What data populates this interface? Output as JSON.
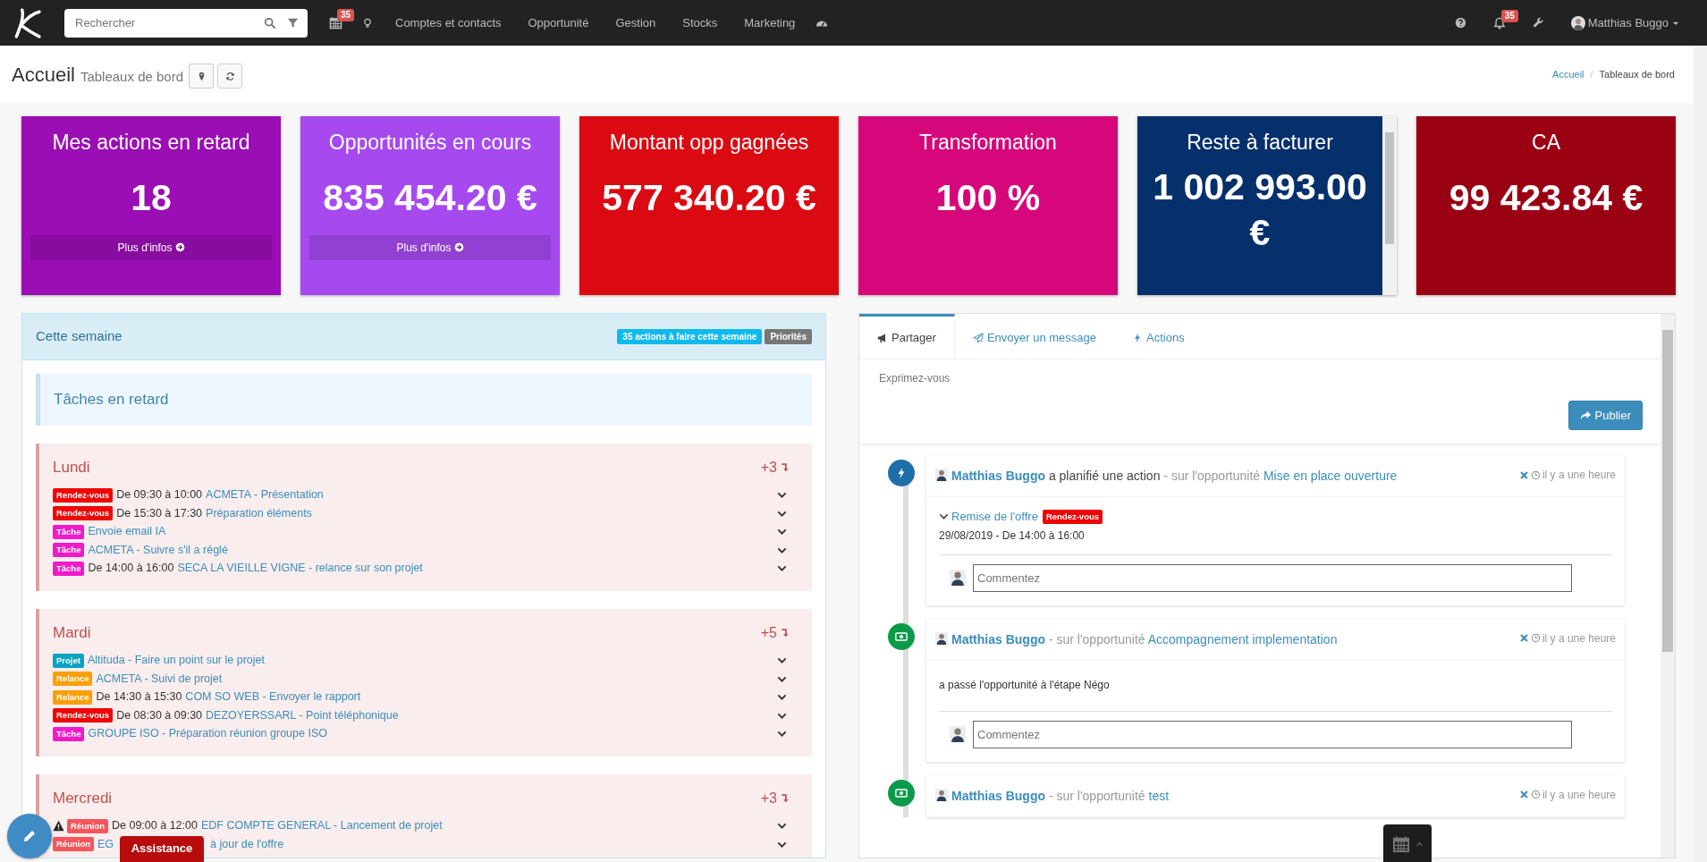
{
  "navbar": {
    "search": {
      "placeholder": "Rechercher"
    },
    "calendar_badge": "35",
    "menu": [
      "Comptes et contacts",
      "Opportunité",
      "Gestion",
      "Stocks",
      "Marketing"
    ],
    "notifications_badge": "35",
    "user": "Matthias Buggo"
  },
  "header": {
    "title": "Accueil",
    "subtitle": "Tableaux de bord",
    "breadcrumb": [
      {
        "label": "Accueil",
        "link": true
      },
      {
        "label": "Tableaux de bord",
        "link": false
      }
    ],
    "separator": "/"
  },
  "kpis": [
    {
      "title": "Mes actions en retard",
      "value": "18",
      "link": "Plus d'infos",
      "color": "#9b0eb5",
      "scrollable": false
    },
    {
      "title": "Opportunités en cours",
      "value": "835 454.20 €",
      "link": "Plus d'infos",
      "color": "#a64af0",
      "scrollable": false
    },
    {
      "title": "Montant opp gagnées",
      "value": "577 340.20 €",
      "color": "#db0a12",
      "scrollable": false
    },
    {
      "title": "Transformation",
      "value": "100 %",
      "color": "#d6077a",
      "scrollable": false
    },
    {
      "title": "Reste à facturer",
      "value": "1 002 993.00 €",
      "color": "#06306b",
      "scrollable": true
    },
    {
      "title": "CA",
      "value": "99 423.84 €",
      "color": "#9a0213",
      "scrollable": false
    }
  ],
  "week": {
    "title": "Cette semaine",
    "badges": [
      {
        "label": "35 actions à faire cette semaine",
        "kind": "info"
      },
      {
        "label": "Priorités",
        "kind": "secondary"
      }
    ],
    "overdue": "Tâches en retard",
    "days": [
      {
        "name": "Lundi",
        "more": "+3",
        "items": [
          {
            "kind": "rdv",
            "type": "Rendez-vous",
            "time": "De 09:30 à 10:00",
            "link": "ACMETA - Présentation"
          },
          {
            "kind": "rdv",
            "type": "Rendez-vous",
            "time": "De 15:30 à 17:30",
            "link": "Préparation éléments"
          },
          {
            "kind": "tache",
            "type": "Tâche",
            "link": "Envoie email IA"
          },
          {
            "kind": "tache",
            "type": "Tâche",
            "link": "ACMETA - Suivre s'il a réglé"
          },
          {
            "kind": "tache",
            "type": "Tâche",
            "time": "De 14:00 à 16:00",
            "link": "SECA LA VIEILLE VIGNE - relance sur son projet"
          }
        ]
      },
      {
        "name": "Mardi",
        "more": "+5",
        "items": [
          {
            "kind": "projet",
            "type": "Projet",
            "link": "Altituda - Faire un point sur le projet"
          },
          {
            "kind": "relance",
            "type": "Relance",
            "link": "ACMETA - Suivi de projet"
          },
          {
            "kind": "relance",
            "type": "Relance",
            "time": "De 14:30 à 15:30",
            "link": "COM SO WEB - Envoyer le rapport"
          },
          {
            "kind": "rdv",
            "type": "Rendez-vous",
            "time": "De 08:30 à 09:30",
            "link": "DEZOYERSSARL - Point téléphonique"
          },
          {
            "kind": "tache",
            "type": "Tâche",
            "link": "GROUPE ISO - Préparation réunion groupe ISO"
          }
        ]
      },
      {
        "name": "Mercredi",
        "more": "+3",
        "items": [
          {
            "kind": "reunion",
            "type": "Réunion",
            "warning": true,
            "time": "De 09:00 à 12:00",
            "link": "EDF COMPTE GENERAL - Lancement de projet"
          },
          {
            "kind": "reunion",
            "type": "Réunion",
            "link_parts": [
              "EG",
              "à jour de l'offre"
            ]
          }
        ]
      }
    ]
  },
  "feed": {
    "tabs": [
      {
        "kind": "share",
        "label": "Partager",
        "selected": true
      },
      {
        "kind": "message",
        "label": "Envoyer un message",
        "selected": false
      },
      {
        "kind": "actions",
        "label": "Actions",
        "selected": false
      }
    ],
    "composer": {
      "placeholder": "Exprimez-vous"
    },
    "publish": "Publier",
    "entries": [
      {
        "kind": "action",
        "author": "Matthias Buggo",
        "verb": "a planifié une action",
        "context": "- sur l'opportunité",
        "target": "Mise en place ouverture",
        "time": "il y a une heure",
        "detail": {
          "title": "Remise de l'offre",
          "tag": {
            "label": "Rendez-vous",
            "kind": "rdv"
          },
          "when": "29/08/2019 - De 14:00 à 16:00"
        },
        "comment": {
          "placeholder": "Commentez"
        }
      },
      {
        "kind": "opportunity",
        "author": "Matthias Buggo",
        "context": "- sur l'opportunité",
        "target": "Accompagnement implementation",
        "time": "il y a une heure",
        "body": "a passé l'opportunité à l'étape Négo",
        "comment": {
          "placeholder": "Commentez"
        }
      },
      {
        "kind": "opportunity",
        "author": "Matthias Buggo",
        "context": "- sur l'opportunité",
        "target": "test",
        "time": "il y a une heure"
      }
    ]
  },
  "assistance": "Assistance"
}
